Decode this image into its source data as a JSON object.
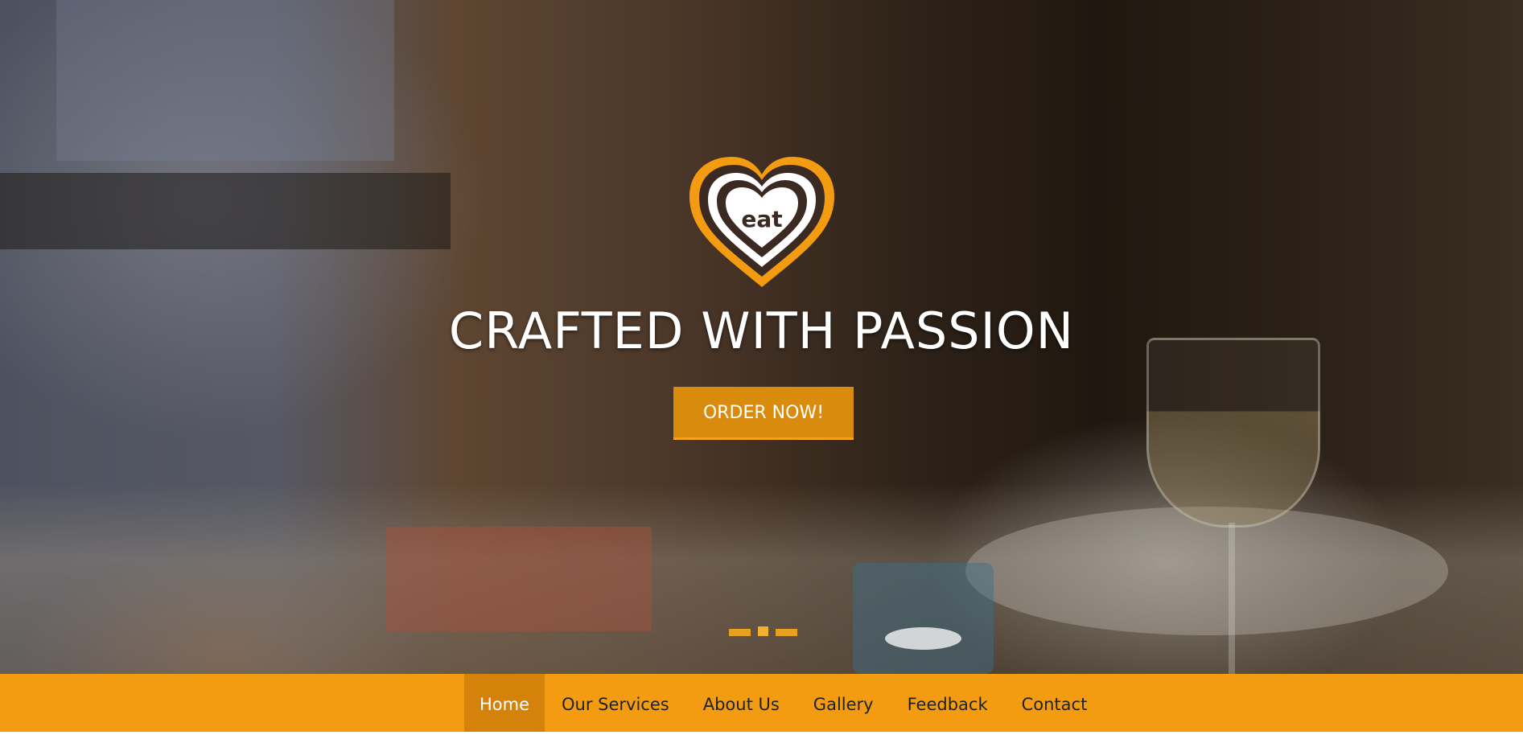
{
  "hero": {
    "logo_text": "eat",
    "headline": "CRAFTED WITH PASSION",
    "cta_label": "ORDER NOW!",
    "slides": [
      "slide-1",
      "slide-2",
      "slide-3"
    ],
    "active_slide": 2
  },
  "nav": {
    "items": [
      {
        "label": "Home",
        "active": true
      },
      {
        "label": "Our Services",
        "active": false
      },
      {
        "label": "About Us",
        "active": false
      },
      {
        "label": "Gallery",
        "active": false
      },
      {
        "label": "Feedback",
        "active": false
      },
      {
        "label": "Contact",
        "active": false
      }
    ]
  },
  "colors": {
    "accent": "#f39c12",
    "accent_dark": "#d4820a",
    "button": "#d98b0e",
    "logo_brown": "#3b2a22",
    "text_light": "#ffffff"
  }
}
